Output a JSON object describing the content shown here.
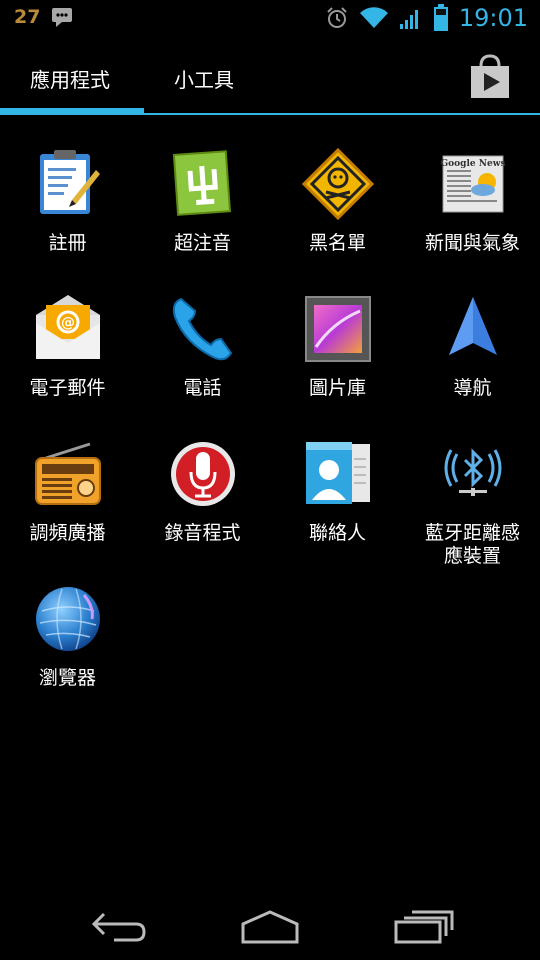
{
  "status_bar": {
    "notification_number": "27",
    "time": "19:01",
    "icons": [
      "sms-notification-icon",
      "alarm-clock-icon",
      "wifi-icon",
      "signal-icon",
      "battery-icon"
    ]
  },
  "tabs": {
    "apps_label": "應用程式",
    "widgets_label": "小工具",
    "store_icon": "play-store-icon",
    "accent": "#33b5e5"
  },
  "apps": [
    {
      "label": "註冊",
      "icon": "notepad-register-icon"
    },
    {
      "label": "超注音",
      "icon": "zhuyin-keyboard-icon"
    },
    {
      "label": "黑名單",
      "icon": "blacklist-sign-icon"
    },
    {
      "label": "新聞與氣象",
      "icon": "google-news-icon",
      "icon_text": "Google News"
    },
    {
      "label": "電子郵件",
      "icon": "email-envelope-icon"
    },
    {
      "label": "電話",
      "icon": "phone-handset-icon"
    },
    {
      "label": "圖片庫",
      "icon": "gallery-icon"
    },
    {
      "label": "導航",
      "icon": "navigation-arrow-icon"
    },
    {
      "label": "調頻廣播",
      "icon": "fm-radio-icon"
    },
    {
      "label": "錄音程式",
      "icon": "voice-recorder-icon"
    },
    {
      "label": "聯絡人",
      "icon": "contacts-icon"
    },
    {
      "label": "藍牙距離感\n應裝置",
      "icon": "bluetooth-icon"
    },
    {
      "label": "瀏覽器",
      "icon": "browser-globe-icon"
    }
  ],
  "nav": {
    "icons": [
      "back-icon",
      "home-icon",
      "recent-apps-icon"
    ]
  }
}
